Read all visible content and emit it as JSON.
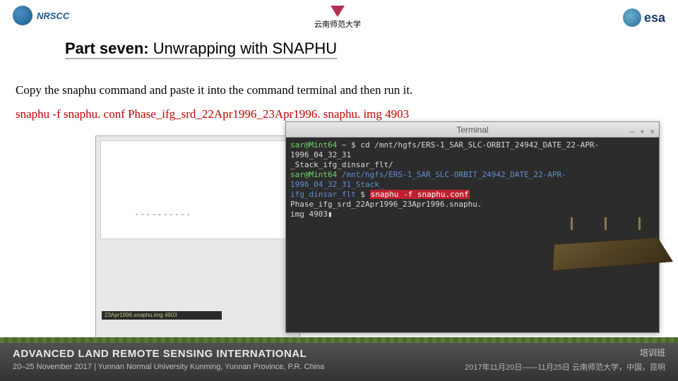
{
  "logos": {
    "left_text": "NRSCC",
    "center_cn": "云南师范大学",
    "right_text": "esa"
  },
  "title": {
    "bold": "Part seven:",
    "rest": " Unwrapping with SNAPHU"
  },
  "body": {
    "line1": "Copy the snaphu command and paste it into the command terminal and then run it.",
    "line2": "snaphu -f snaphu. conf Phase_ifg_srd_22Apr1996_23Apr1996. snaphu. img 4903"
  },
  "back_window": {
    "dots": "- - - - - - - - - -",
    "bottom_line": "23Apr1996.snaphu.img 4903"
  },
  "terminal": {
    "title": "Terminal",
    "controls": [
      "–",
      "+",
      "×"
    ],
    "line1_user": "sar@Mint64",
    "line1_path": " ~ $ ",
    "line1_cmd": "cd /mnt/hgfs/ERS-1_SAR_SLC-ORBIT_24942_DATE_22-APR-1996_04_32_31",
    "line2_cont": "_Stack_ifg_dinsar_flt/",
    "line3_user": "sar@Mint64",
    "line3_path1": " /mnt/hgfs/ERS-1_SAR_SLC-ORBIT_24942_DATE_22-APR-1996_04_32_31_Stack_",
    "line4_path2": "ifg_dinsar_flt",
    "line4_dollar": " $ ",
    "line4_cmd_p1": "snaphu -f snaphu.conf",
    "line4_cmd_p2": " Phase_ifg_srd_22Apr1996_23Apr1996.snaphu.",
    "line5_cmd": "img 4903",
    "cursor": "▮"
  },
  "footer": {
    "title": "ADVANCED LAND REMOTE SENSING INTERNATIONAL",
    "sub": "20–25 November 2017 | Yunnan Normal University Kunming, Yunnan Province, P.R. China",
    "cn1": "培训班",
    "cn2": "2017年11月20日——11月25日   云南师范大学，中国，昆明"
  }
}
